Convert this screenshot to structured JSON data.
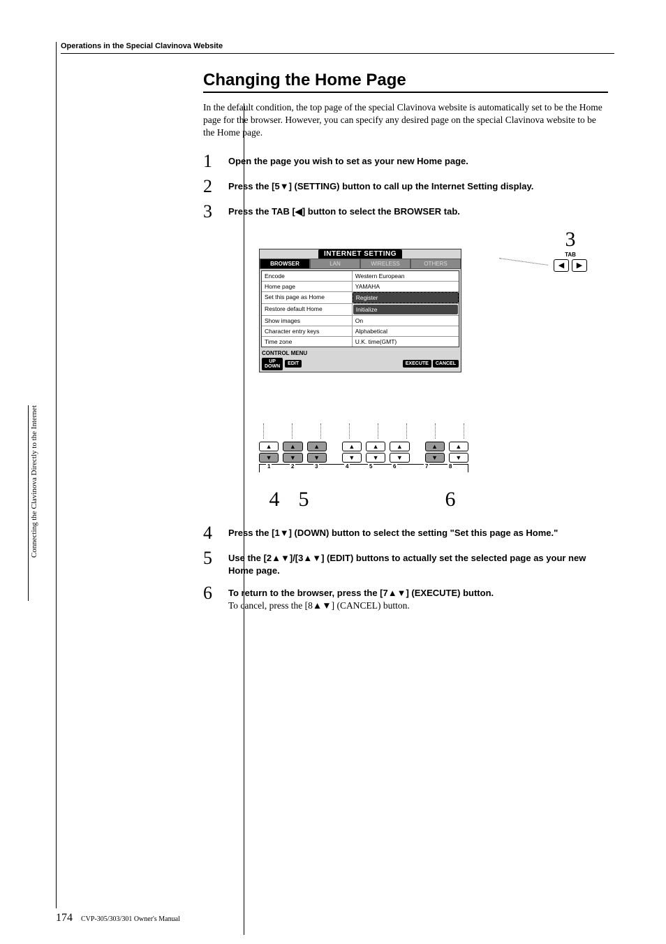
{
  "breadcrumb": "Operations in the Special Clavinova Website",
  "heading": "Changing the Home Page",
  "intro": "In the default condition, the top page of the special Clavinova website is automatically set to be the Home page for the browser. However, you can specify any desired page on the special Clavinova website to be the Home page.",
  "steps": {
    "s1": {
      "num": "1",
      "bold": "Open the page you wish to set as your new Home page."
    },
    "s2": {
      "num": "2",
      "bold": "Press the [5▼] (SETTING) button to call up the Internet Setting display."
    },
    "s3": {
      "num": "3",
      "bold": "Press the TAB [◀] button to select the BROWSER tab."
    },
    "s4": {
      "num": "4",
      "bold": "Press the [1▼] (DOWN) button to select the setting \"Set this page as Home.\""
    },
    "s5": {
      "num": "5",
      "bold": "Use the [2▲▼]/[3▲▼] (EDIT) buttons to actually set the selected page as your new Home page."
    },
    "s6": {
      "num": "6",
      "bold": "To return to the browser, press the [7▲▼] (EXECUTE) button.",
      "plain": "To cancel, press the [8▲▼] (CANCEL) button."
    }
  },
  "panel": {
    "title": "INTERNET SETTING",
    "tabs": [
      "BROWSER",
      "LAN",
      "WIRELESS",
      "OTHERS"
    ],
    "rows": [
      {
        "label": "Encode",
        "value": "Western European"
      },
      {
        "label": "Home page",
        "value": "YAMAHA"
      },
      {
        "label": "Set this page as Home",
        "value": "Register"
      },
      {
        "label": "Restore default Home",
        "value": "Initialize"
      },
      {
        "label": "Show images",
        "value": "On"
      },
      {
        "label": "Character entry keys",
        "value": "Alphabetical"
      },
      {
        "label": "Time zone",
        "value": "U.K. time(GMT)"
      }
    ],
    "control_menu": "CONTROL MENU",
    "cm_up": "UP",
    "cm_down": "DOWN",
    "cm_edit": "EDIT",
    "cm_execute": "EXECUTE",
    "cm_cancel": "CANCEL"
  },
  "tab_callout": {
    "num": "3",
    "label": "TAB",
    "left": "◀",
    "right": "▶"
  },
  "btn_numbers": [
    "1",
    "2",
    "3",
    "4",
    "5",
    "6",
    "7",
    "8"
  ],
  "callouts": {
    "c4": "4",
    "c5": "5",
    "c6": "6"
  },
  "side_text": "Connecting the Clavinova Directly to the Internet",
  "footer": {
    "page": "174",
    "ref": "CVP-305/303/301 Owner's Manual"
  }
}
